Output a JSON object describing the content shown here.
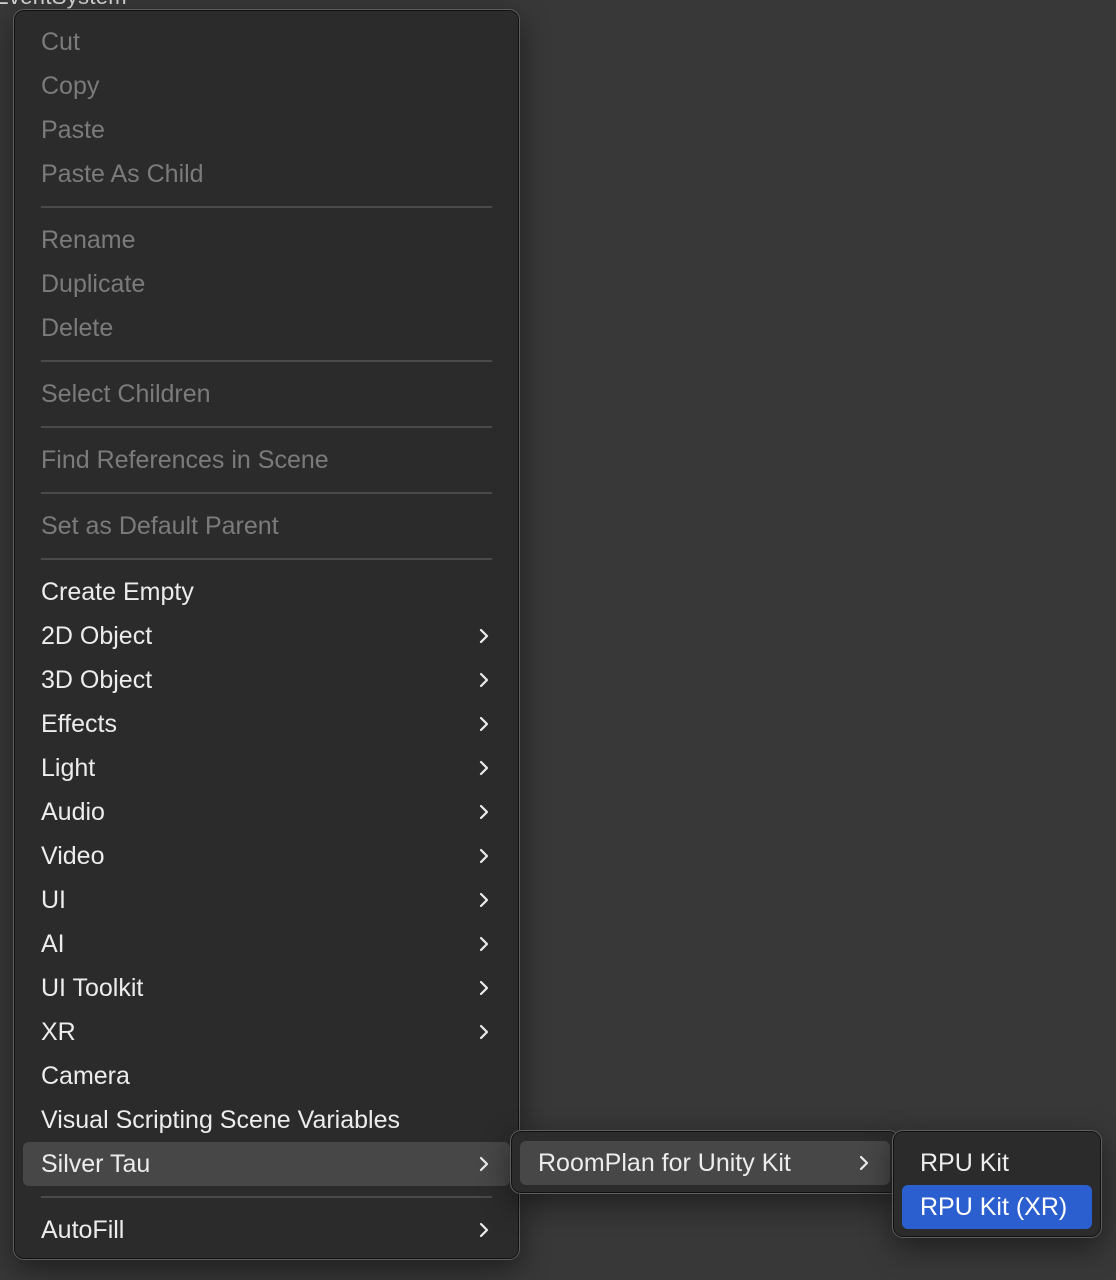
{
  "background": {
    "title_fragment": "EventSystem"
  },
  "context_menu": {
    "groups": [
      [
        {
          "label": "Cut",
          "enabled": false
        },
        {
          "label": "Copy",
          "enabled": false
        },
        {
          "label": "Paste",
          "enabled": false
        },
        {
          "label": "Paste As Child",
          "enabled": false
        }
      ],
      [
        {
          "label": "Rename",
          "enabled": false
        },
        {
          "label": "Duplicate",
          "enabled": false
        },
        {
          "label": "Delete",
          "enabled": false
        }
      ],
      [
        {
          "label": "Select Children",
          "enabled": false
        }
      ],
      [
        {
          "label": "Find References in Scene",
          "enabled": false
        }
      ],
      [
        {
          "label": "Set as Default Parent",
          "enabled": false
        }
      ],
      [
        {
          "label": "Create Empty",
          "enabled": true,
          "submenu": false
        },
        {
          "label": "2D Object",
          "enabled": true,
          "submenu": true
        },
        {
          "label": "3D Object",
          "enabled": true,
          "submenu": true
        },
        {
          "label": "Effects",
          "enabled": true,
          "submenu": true
        },
        {
          "label": "Light",
          "enabled": true,
          "submenu": true
        },
        {
          "label": "Audio",
          "enabled": true,
          "submenu": true
        },
        {
          "label": "Video",
          "enabled": true,
          "submenu": true
        },
        {
          "label": "UI",
          "enabled": true,
          "submenu": true
        },
        {
          "label": "AI",
          "enabled": true,
          "submenu": true
        },
        {
          "label": "UI Toolkit",
          "enabled": true,
          "submenu": true
        },
        {
          "label": "XR",
          "enabled": true,
          "submenu": true
        },
        {
          "label": "Camera",
          "enabled": true,
          "submenu": false
        },
        {
          "label": "Visual Scripting Scene Variables",
          "enabled": true,
          "submenu": false
        },
        {
          "label": "Silver Tau",
          "enabled": true,
          "submenu": true,
          "open": true
        }
      ],
      [
        {
          "label": "AutoFill",
          "enabled": true,
          "submenu": true
        }
      ]
    ]
  },
  "submenu_silver_tau": {
    "items": [
      {
        "label": "RoomPlan for Unity Kit",
        "submenu": true,
        "open": true
      }
    ]
  },
  "submenu_roomplan": {
    "items": [
      {
        "label": "RPU Kit",
        "selected": false
      },
      {
        "label": "RPU Kit (XR)",
        "selected": true
      }
    ]
  },
  "colors": {
    "background": "#383838",
    "menu_background": "#2b2b2b",
    "text_enabled": "#ececec",
    "text_disabled": "#7b7b7b",
    "open_highlight": "#474747",
    "selection_accent": "#2b5fcf"
  },
  "icons": {
    "submenu_indicator": "chevron-right-icon"
  }
}
